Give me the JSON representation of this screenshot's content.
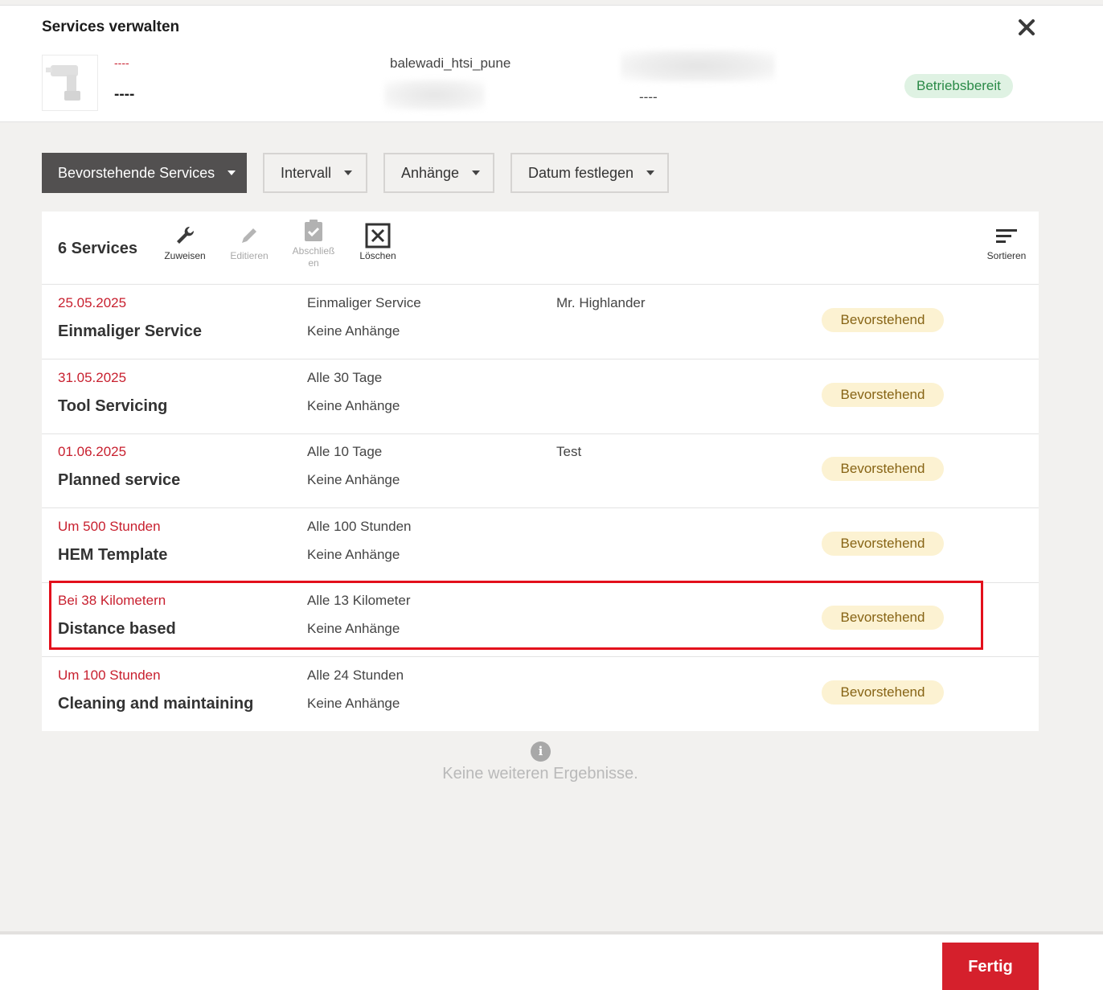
{
  "dialog": {
    "title": "Services verwalten",
    "close_icon": "close-icon"
  },
  "asset": {
    "image_icon": "drill-icon",
    "code": "----",
    "name": "----",
    "location": "balewadi_htsi_pune",
    "serial": "----",
    "status": "Betriebsbereit",
    "status_color": "#2a8a47"
  },
  "filters": {
    "view": "Bevorstehende Services",
    "interval": "Intervall",
    "attachments": "Anhänge",
    "date": "Datum festlegen"
  },
  "toolbar": {
    "count": "6 Services",
    "assign": "Zuweisen",
    "edit": "Editieren",
    "complete_line1": "Abschließ",
    "complete_line2": "en",
    "delete": "Löschen",
    "sort": "Sortieren"
  },
  "services": [
    {
      "due": "25.05.2025",
      "name": "Einmaliger Service",
      "interval": "Einmaliger Service",
      "attachments": "Keine Anhänge",
      "assignee": "Mr. Highlander",
      "status": "Bevorstehend"
    },
    {
      "due": "31.05.2025",
      "name": "Tool Servicing",
      "interval": "Alle 30 Tage",
      "attachments": "Keine Anhänge",
      "assignee": "",
      "status": "Bevorstehend"
    },
    {
      "due": "01.06.2025",
      "name": "Planned service",
      "interval": "Alle 10 Tage",
      "attachments": "Keine Anhänge",
      "assignee": "Test",
      "status": "Bevorstehend"
    },
    {
      "due": "Um 500 Stunden",
      "name": "HEM Template",
      "interval": "Alle 100 Stunden",
      "attachments": "Keine Anhänge",
      "assignee": "",
      "status": "Bevorstehend"
    },
    {
      "due": "Bei 38 Kilometern",
      "name": "Distance based",
      "interval": "Alle 13 Kilometer",
      "attachments": "Keine Anhänge",
      "assignee": "",
      "status": "Bevorstehend"
    },
    {
      "due": "Um 100 Stunden",
      "name": "Cleaning and maintaining",
      "interval": "Alle 24 Stunden",
      "attachments": "Keine Anhänge",
      "assignee": "",
      "status": "Bevorstehend"
    }
  ],
  "no_more": "Keine weiteren Ergebnisse.",
  "done_button": "Fertig",
  "colors": {
    "accent": "#d5202c",
    "due_text": "#c8202f",
    "badge_bg": "#fcf2d2",
    "badge_text": "#876415",
    "highlight": "#e3101c"
  }
}
